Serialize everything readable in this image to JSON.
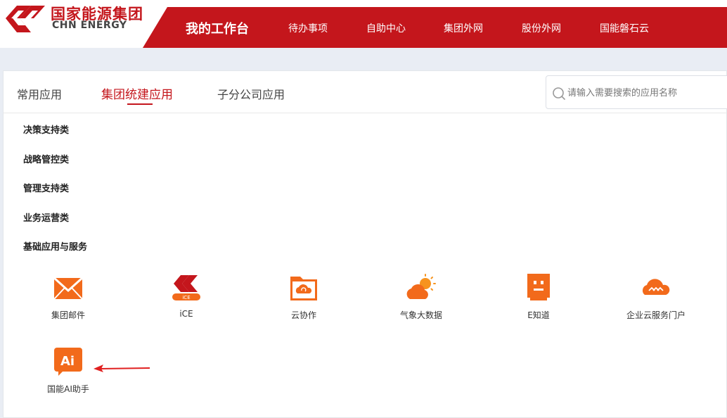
{
  "header": {
    "logo_cn": "国家能源集团",
    "logo_en": "CHN ENERGY",
    "nav_main": "我的工作台",
    "nav_items": [
      "待办事项",
      "自助中心",
      "集团外网",
      "股份外网",
      "国能磐石云"
    ]
  },
  "tabs": [
    "常用应用",
    "集团统建应用",
    "子分公司应用"
  ],
  "active_tab": "集团统建应用",
  "search": {
    "placeholder": "请输入需要搜索的应用名称",
    "icon": "search-icon"
  },
  "categories": [
    "决策支持类",
    "战略管控类",
    "管理支持类",
    "业务运营类",
    "基础应用与服务"
  ],
  "apps": [
    {
      "label": "集团邮件",
      "icon": "mail-icon"
    },
    {
      "label": "iCE",
      "icon": "ice-logo-icon"
    },
    {
      "label": "云协作",
      "icon": "cloud-folder-icon"
    },
    {
      "label": "气象大数据",
      "icon": "weather-icon"
    },
    {
      "label": "E知道",
      "icon": "robot-face-icon"
    },
    {
      "label": "企业云服务门户",
      "icon": "cloud-portal-icon"
    },
    {
      "label": "国能AI助手",
      "icon": "ai-assistant-icon"
    }
  ],
  "colors": {
    "brand_red": "#c4161c",
    "app_orange": "#f26a1b",
    "background": "#e9edf4"
  }
}
